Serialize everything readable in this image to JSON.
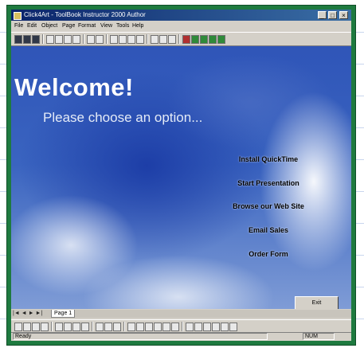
{
  "window": {
    "title": "Click4Art - ToolBook Instructor 2000 Author",
    "minimize_label": "_",
    "maximize_label": "□",
    "close_label": "×"
  },
  "menu": [
    "File",
    "Edit",
    "Object",
    "Page",
    "Format",
    "View",
    "Tools",
    "Help"
  ],
  "toolbar": {
    "icons": [
      "new-icon",
      "open-icon",
      "save-icon",
      "print-icon",
      "cut-icon",
      "copy-icon",
      "paste-icon",
      "undo-icon",
      "redo-icon",
      "tool-icon",
      "tool-icon",
      "tool-icon",
      "tool-icon",
      "zoom-icon",
      "tool-icon",
      "help-icon",
      "palette-icon",
      "palette-icon",
      "palette-icon",
      "palette-icon",
      "palette-icon"
    ]
  },
  "stage": {
    "heading": "Welcome!",
    "subheading": "Please choose an option...",
    "options": [
      "Install QuickTime",
      "Start Presentation",
      "Browse our Web Site",
      "Email Sales",
      "Order Form"
    ],
    "exit_label": "Exit"
  },
  "page_tabs": {
    "nav": "|◄ ◄ ► ►|",
    "current_tab": "Page 1"
  },
  "statusbar": {
    "left_text": "Ready",
    "right_text": "NUM"
  },
  "colors": {
    "frame": "#1e7a3f",
    "sky": "#2f55b8",
    "title_bar": "#0a246a"
  }
}
